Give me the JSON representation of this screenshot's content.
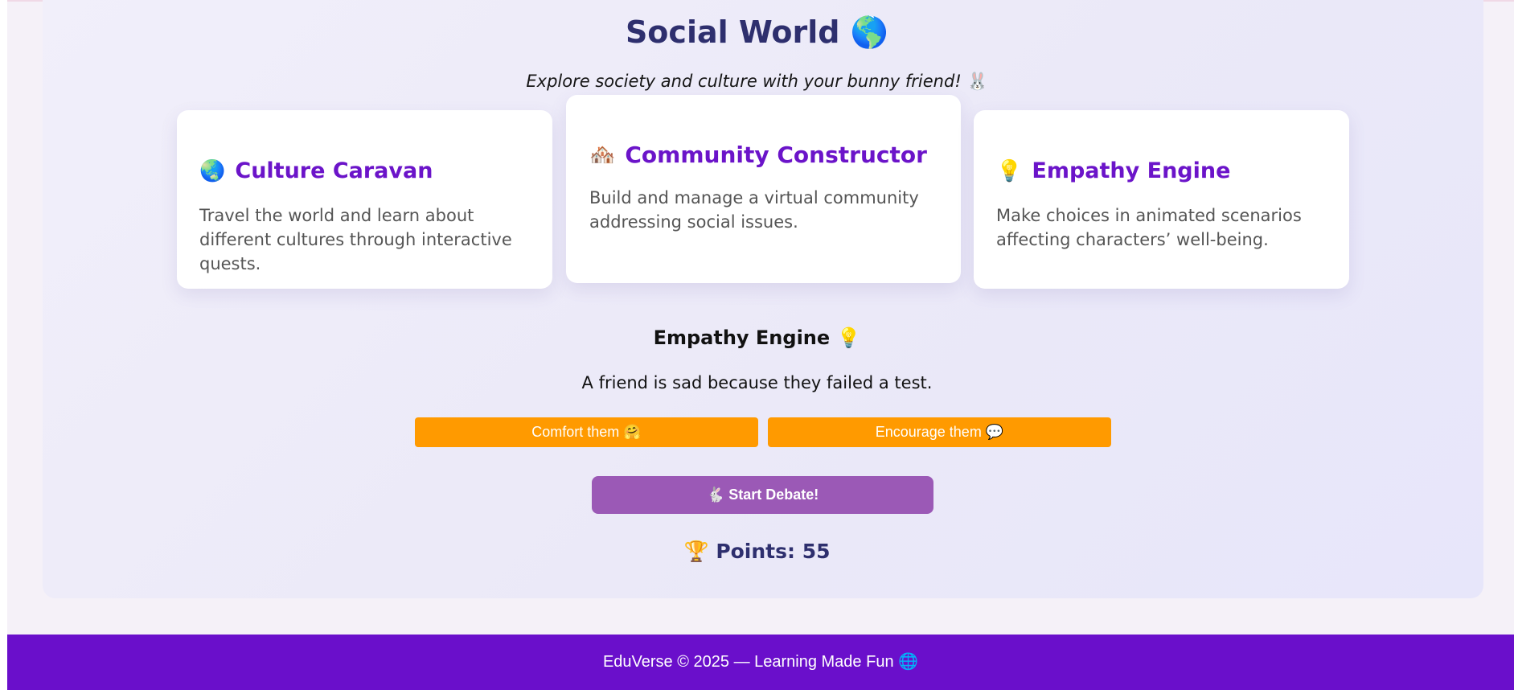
{
  "header": {
    "title": "Social World",
    "title_emoji": "🌎",
    "subtitle": "Explore society and culture with your bunny friend!",
    "subtitle_emoji": "🐰"
  },
  "cards": [
    {
      "icon": "🌏",
      "icon_name": "globe-icon",
      "title": "Culture Caravan",
      "description": "Travel the world and learn about different cultures through interactive quests."
    },
    {
      "icon": "🏘️",
      "icon_name": "houses-icon",
      "title": "Community Constructor",
      "description": "Build and manage a virtual community addressing social issues."
    },
    {
      "icon": "💡",
      "icon_name": "lightbulb-icon",
      "title": "Empathy Engine",
      "description": "Make choices in animated scenarios affecting characters’ well-being."
    }
  ],
  "activity": {
    "title": "Empathy Engine",
    "title_emoji": "💡",
    "scenario": "A friend is sad because they failed a test.",
    "choices": [
      {
        "label": "Comfort them",
        "emoji": "🤗"
      },
      {
        "label": "Encourage them",
        "emoji": "💬"
      }
    ]
  },
  "debate_button": {
    "emoji": "🐇",
    "label": "Start Debate!"
  },
  "points": {
    "emoji": "🏆",
    "label": "Points:",
    "value": "55"
  },
  "footer": {
    "text": "EduVerse © 2025 — Learning Made Fun",
    "emoji": "🌐"
  },
  "colors": {
    "accent_purple": "#6a0fcb",
    "title_navy": "#2e2f6e",
    "choice_orange": "#ff9a00",
    "debate_purple": "#9b59b6",
    "card_title_purple": "#6b14c9"
  }
}
